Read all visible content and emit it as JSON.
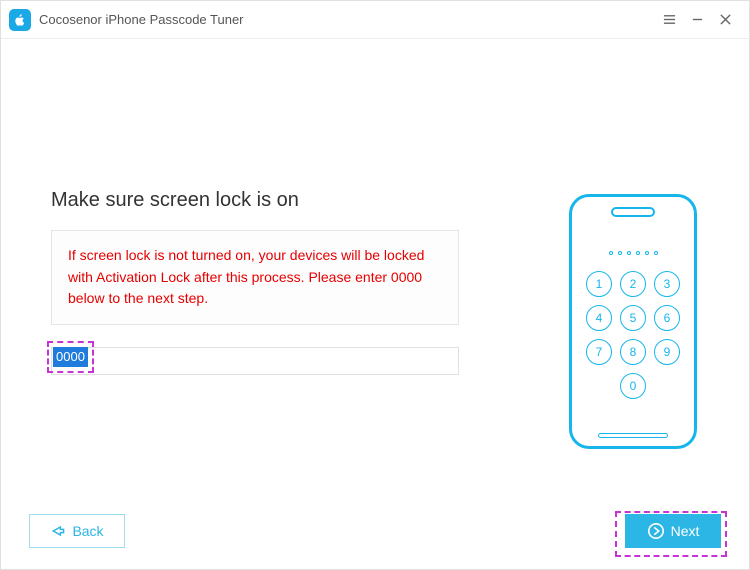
{
  "titlebar": {
    "title": "Cocosenor iPhone Passcode Tuner"
  },
  "main": {
    "heading": "Make sure screen lock is on",
    "warning": "If screen lock is not turned on, your devices will be locked with Activation Lock after this process. Please enter 0000 below to the next step.",
    "passcode_value": "0000"
  },
  "phone": {
    "keys": [
      "1",
      "2",
      "3",
      "4",
      "5",
      "6",
      "7",
      "8",
      "9",
      "0"
    ]
  },
  "footer": {
    "back_label": "Back",
    "next_label": "Next"
  }
}
